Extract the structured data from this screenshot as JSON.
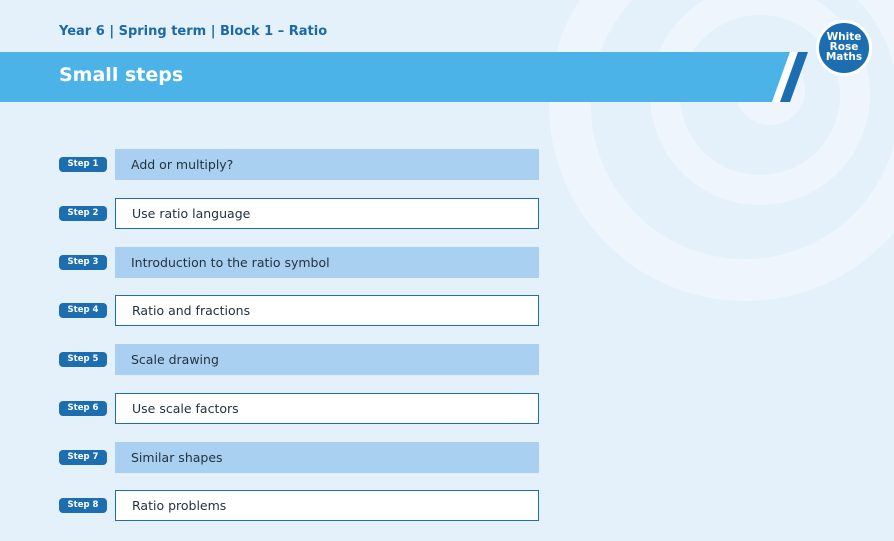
{
  "header": {
    "title": "Year 6 | Spring term | Block 1 – Ratio"
  },
  "banner": {
    "title": "Small steps"
  },
  "logo": {
    "line1": "White",
    "line2": "Rose",
    "line3": "Maths"
  },
  "colors": {
    "primary": "#1d6eb1",
    "banner": "#4cb3e8",
    "filled_row": "#a9d0f0",
    "background": "#e4f0fa"
  },
  "steps": [
    {
      "label": "Step 1",
      "title": "Add or multiply?",
      "style": "filled"
    },
    {
      "label": "Step 2",
      "title": "Use ratio language",
      "style": "outline"
    },
    {
      "label": "Step 3",
      "title": "Introduction to the ratio symbol",
      "style": "filled"
    },
    {
      "label": "Step 4",
      "title": "Ratio and fractions",
      "style": "outline"
    },
    {
      "label": "Step 5",
      "title": "Scale drawing",
      "style": "filled"
    },
    {
      "label": "Step 6",
      "title": "Use scale factors",
      "style": "outline"
    },
    {
      "label": "Step 7",
      "title": "Similar shapes",
      "style": "filled"
    },
    {
      "label": "Step 8",
      "title": "Ratio problems",
      "style": "outline"
    }
  ]
}
